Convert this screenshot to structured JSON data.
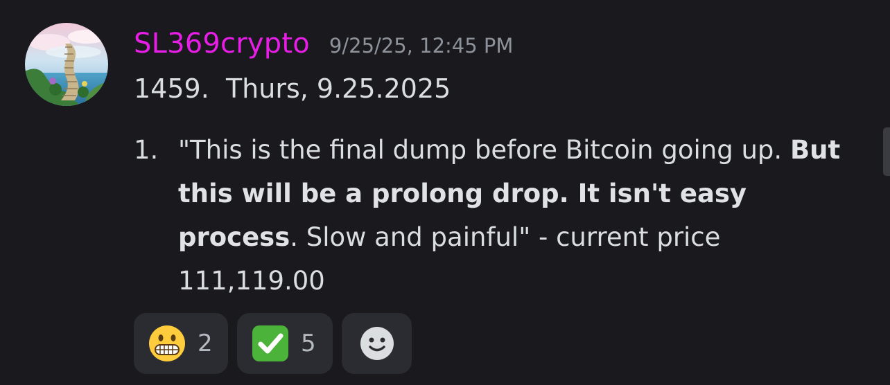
{
  "message": {
    "author": "SL369crypto",
    "timestamp": "9/25/25, 12:45 PM",
    "title_line": "1459.  Thurs, 9.25.2025",
    "list": [
      {
        "number": "1.",
        "text_plain_start": "\"This is the final dump before Bitcoin going up. ",
        "text_bold": "But this will be a prolong drop. It isn't easy process",
        "text_plain_end": ". Slow and painful\" - current price 111,119.00"
      }
    ]
  },
  "reactions": [
    {
      "emoji": "grimacing-face-icon",
      "count": "2"
    },
    {
      "emoji": "check-mark-button-icon",
      "count": "5"
    },
    {
      "emoji": "add-reaction-icon",
      "count": ""
    }
  ],
  "colors": {
    "background": "#1a1a1e",
    "author": "#e61ee6",
    "timestamp": "#8d929b",
    "reaction_bg": "#2b2c31"
  }
}
